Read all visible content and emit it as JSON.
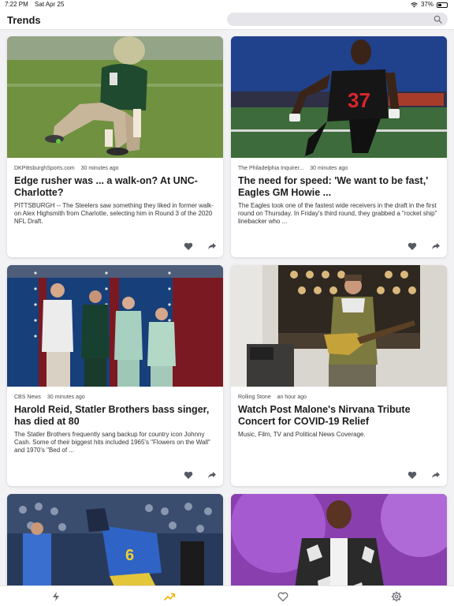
{
  "status_bar": {
    "time": "7:22 PM",
    "date": "Sat Apr 25",
    "battery": "37%",
    "battery_level": 0.37
  },
  "header": {
    "title": "Trends",
    "search_placeholder": ""
  },
  "cards": [
    {
      "source": "DKPittsburghSports.com",
      "time": "30 minutes ago",
      "headline": "Edge rusher was ... a walk-on? At UNC-Charlotte?",
      "summary": "PITTSBURGH -- The Steelers saw something they liked in former walk-on Alex Highsmith from Charlotte, selecting him in Round 3 of the 2020 NFL Draft.",
      "image": "football-player-crouching-icon"
    },
    {
      "source": "The Philadelphia Inquirer...",
      "time": "30 minutes ago",
      "headline": "The need for speed: 'We want to be fast,' Eagles GM Howie ...",
      "summary": "The Eagles took one of the fastest wide receivers in the draft in the first round on Thursday. In Friday's third round, they grabbed a \"rocket ship\" linebacker who ...",
      "image": "sprinter-running-icon"
    },
    {
      "source": "CBS News",
      "time": "30 minutes ago",
      "headline": "Harold Reid, Statler Brothers bass singer, has died at 80",
      "summary": "The Statler Brothers frequently sang backup for country icon Johnny Cash. Some of their biggest hits included 1965's \"Flowers on the Wall\" and 1970's \"Bed of ...",
      "image": "singing-quartet-icon"
    },
    {
      "source": "Rolling Stone",
      "time": "an hour ago",
      "headline": "Watch Post Malone's Nirvana Tribute Concert for COVID-19 Relief",
      "summary": "Music, Film, TV and Political News Coverage.",
      "image": "guitarist-performing-icon"
    },
    {
      "source": "",
      "time": "",
      "headline": "",
      "summary": "",
      "image": "football-tackle-icon"
    },
    {
      "source": "",
      "time": "",
      "headline": "",
      "summary": "",
      "image": "rapper-on-stage-icon"
    }
  ],
  "tabbar": {
    "items": [
      "bolt-icon",
      "trending-icon",
      "heart-icon",
      "gear-icon"
    ],
    "active_color": "#f0b400",
    "inactive_color": "#6e6e73"
  }
}
